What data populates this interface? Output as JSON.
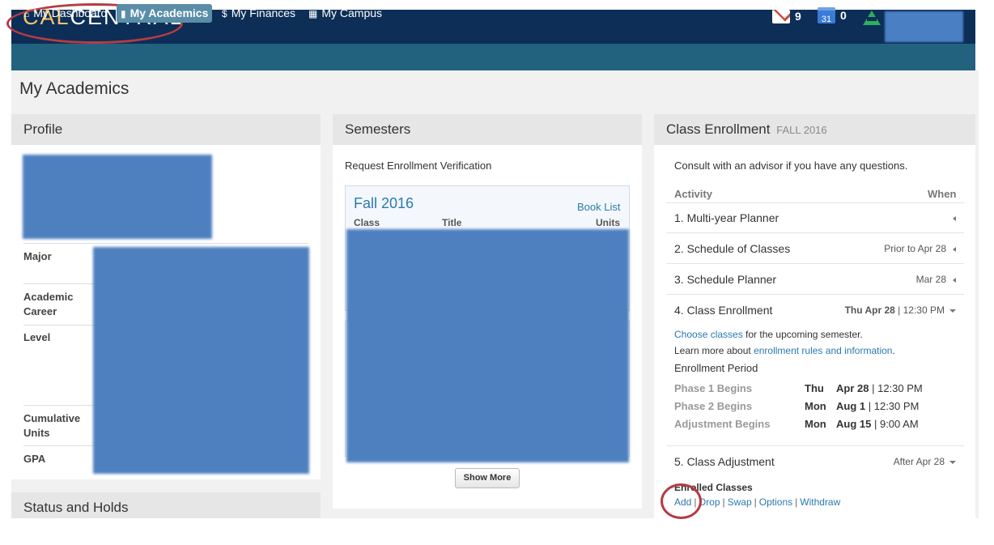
{
  "header": {
    "logo_cal": "CAL",
    "logo_central": "CENTRAL",
    "gmail_count": "9",
    "calendar_day": "31",
    "calendar_count": "0"
  },
  "nav": {
    "items": [
      {
        "icon": "home-icon",
        "glyph": "⌂",
        "label": "My Dashboard",
        "active": false
      },
      {
        "icon": "book-icon",
        "glyph": "▮",
        "label": "My Academics",
        "active": true
      },
      {
        "icon": "dollar-icon",
        "glyph": "$",
        "label": "My Finances",
        "active": false
      },
      {
        "icon": "grid-icon",
        "glyph": "▦",
        "label": "My Campus",
        "active": false
      }
    ]
  },
  "page": {
    "title": "My Academics"
  },
  "profile": {
    "heading": "Profile",
    "labels": {
      "major": "Major",
      "career": "Academic\nCareer",
      "level": "Level",
      "units": "Cumulative\nUnits",
      "gpa": "GPA"
    }
  },
  "status": {
    "heading": "Status and Holds"
  },
  "semesters": {
    "heading": "Semesters",
    "verify_link": "Request Enrollment Verification",
    "term": "Fall 2016",
    "book_list": "Book List",
    "columns": [
      "Class",
      "Title",
      "Units"
    ],
    "show_more": "Show More"
  },
  "enrollment": {
    "heading": "Class Enrollment",
    "term": "FALL 2016",
    "intro": "Consult with an advisor if you have any questions.",
    "col_activity": "Activity",
    "col_when": "When",
    "activities": [
      {
        "label": "1. Multi-year Planner",
        "when": ""
      },
      {
        "label": "2. Schedule of Classes",
        "when": "Prior to Apr 28"
      },
      {
        "label": "3. Schedule Planner",
        "when": "Mar 28"
      },
      {
        "label": "4. Class Enrollment",
        "when_bold": "Thu Apr 28",
        "when": "| 12:30 PM"
      }
    ],
    "choose_link": "Choose classes",
    "choose_rest": " for the upcoming semester.",
    "learn_pre": "Learn more about ",
    "learn_link": "enrollment rules and information",
    "learn_post": ".",
    "period_heading": "Enrollment Period",
    "phases": [
      {
        "label": "Phase 1 Begins",
        "day": "Thu",
        "date": "Apr 28",
        "time": "| 12:30 PM"
      },
      {
        "label": "Phase 2 Begins",
        "day": "Mon",
        "date": "Aug 1",
        "time": "| 12:30 PM"
      },
      {
        "label": "Adjustment Begins",
        "day": "Mon",
        "date": "Aug 15",
        "time": "| 9:00 AM"
      }
    ],
    "adjustment": {
      "label": "5. Class Adjustment",
      "when": "After Apr 28"
    },
    "enrolled_heading": "Enrolled Classes",
    "actions": [
      "Add",
      "Drop",
      "Swap",
      "Options",
      "Withdraw"
    ]
  }
}
